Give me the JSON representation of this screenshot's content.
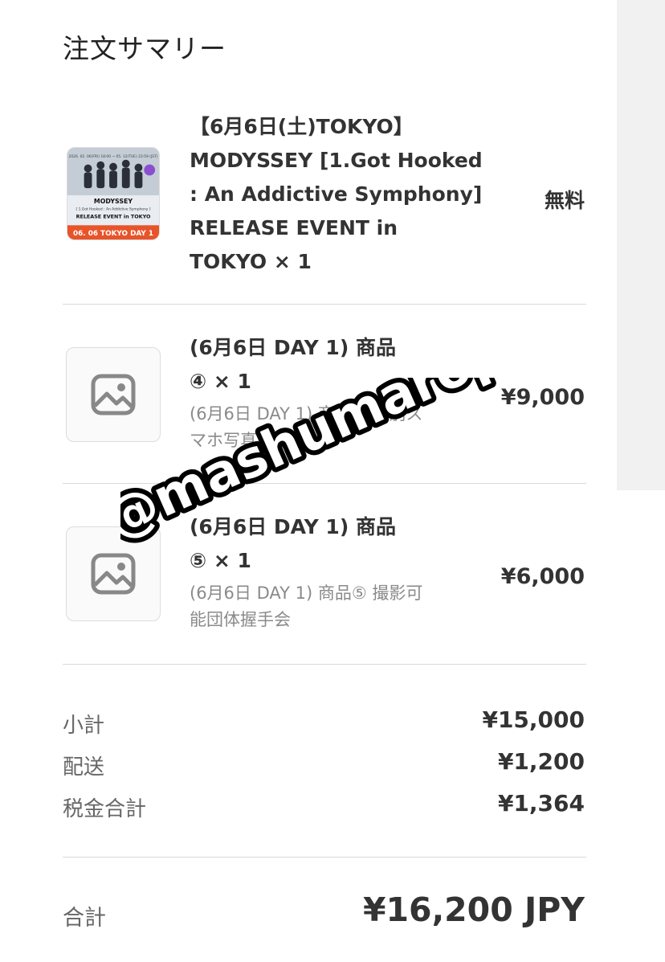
{
  "page": {
    "title": "注文サマリー"
  },
  "items": [
    {
      "name_lines": [
        "【6月6日(土)TOKYO】",
        "MODYSSEY [1.Got Hooked",
        ": An Addictive Symphony]",
        "RELEASE EVENT in",
        "TOKYO × 1"
      ],
      "price": "無料",
      "thumbnail": {
        "top_line": "2026. 02. 06(FRI) 18:00 ~ 05. 12(TUE) 23:59 (JST)",
        "artist": "MODYSSEY",
        "album": "[ 1.Got Hooked : An Addictive Symphony ]",
        "event": "RELEASE EVENT in TOKYO",
        "banner": "06. 06 TOKYO DAY 1"
      }
    },
    {
      "name_lines": [
        "(6月6日 DAY 1) 商品",
        "④ × 1"
      ],
      "variant_lines": [
        "(6月6日 DAY 1) 商品④ 個別ス",
        "マホ写真撮影会"
      ],
      "price": "¥9,000",
      "icon": "image-placeholder-icon"
    },
    {
      "name_lines": [
        "(6月6日 DAY 1) 商品",
        "⑤ × 1"
      ],
      "variant_lines": [
        "(6月6日 DAY 1) 商品⑤ 撮影可",
        "能団体握手会"
      ],
      "price": "¥6,000",
      "icon": "image-placeholder-icon"
    }
  ],
  "summary": [
    {
      "label": "小計",
      "value": "¥15,000"
    },
    {
      "label": "配送",
      "value": "¥1,200"
    },
    {
      "label": "税金合計",
      "value": "¥1,364"
    }
  ],
  "total": {
    "label": "合計",
    "value": "¥16,200 JPY"
  },
  "watermark": {
    "text": "@mashumaropyon_"
  },
  "colors": {
    "banner": "#e8542a",
    "text": "#333333",
    "muted": "#8a8a8a",
    "divider": "#d9d9d9"
  }
}
